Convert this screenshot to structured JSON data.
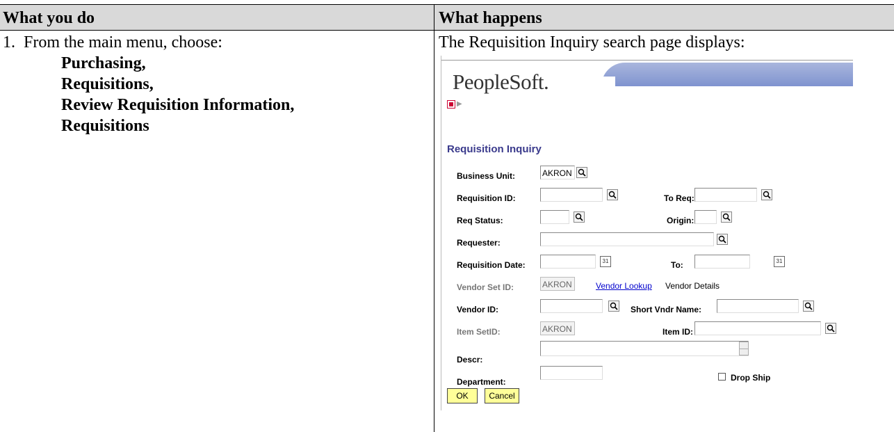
{
  "doc": {
    "col_left_header": "What you do",
    "col_right_header": "What happens",
    "step_number": "1.",
    "step_text": "From the main menu, choose:",
    "menu_path": [
      "Purchasing,",
      "Requisitions,",
      "Review Requisition Information,",
      "Requisitions"
    ],
    "result_text": "The Requisition Inquiry search page displays:"
  },
  "ps": {
    "logo": "PeopleSoft.",
    "page_title": "Requisition Inquiry",
    "labels": {
      "business_unit": "Business Unit:",
      "requisition_id": "Requisition ID:",
      "to_req": "To Req:",
      "req_status": "Req Status:",
      "origin": "Origin:",
      "requester": "Requester:",
      "requisition_date": "Requisition Date:",
      "to": "To:",
      "vendor_set_id": "Vendor Set ID:",
      "vendor_id": "Vendor ID:",
      "short_vndr_name": "Short Vndr Name:",
      "item_setid": "Item SetID:",
      "item_id": "Item ID:",
      "descr": "Descr:",
      "department": "Department:",
      "drop_ship": "Drop Ship"
    },
    "values": {
      "business_unit": "AKRON",
      "vendor_set_id": "AKRON",
      "item_setid": "AKRON"
    },
    "links": {
      "vendor_lookup": "Vendor Lookup",
      "vendor_details": "Vendor Details"
    },
    "buttons": {
      "ok": "OK",
      "cancel": "Cancel"
    }
  }
}
